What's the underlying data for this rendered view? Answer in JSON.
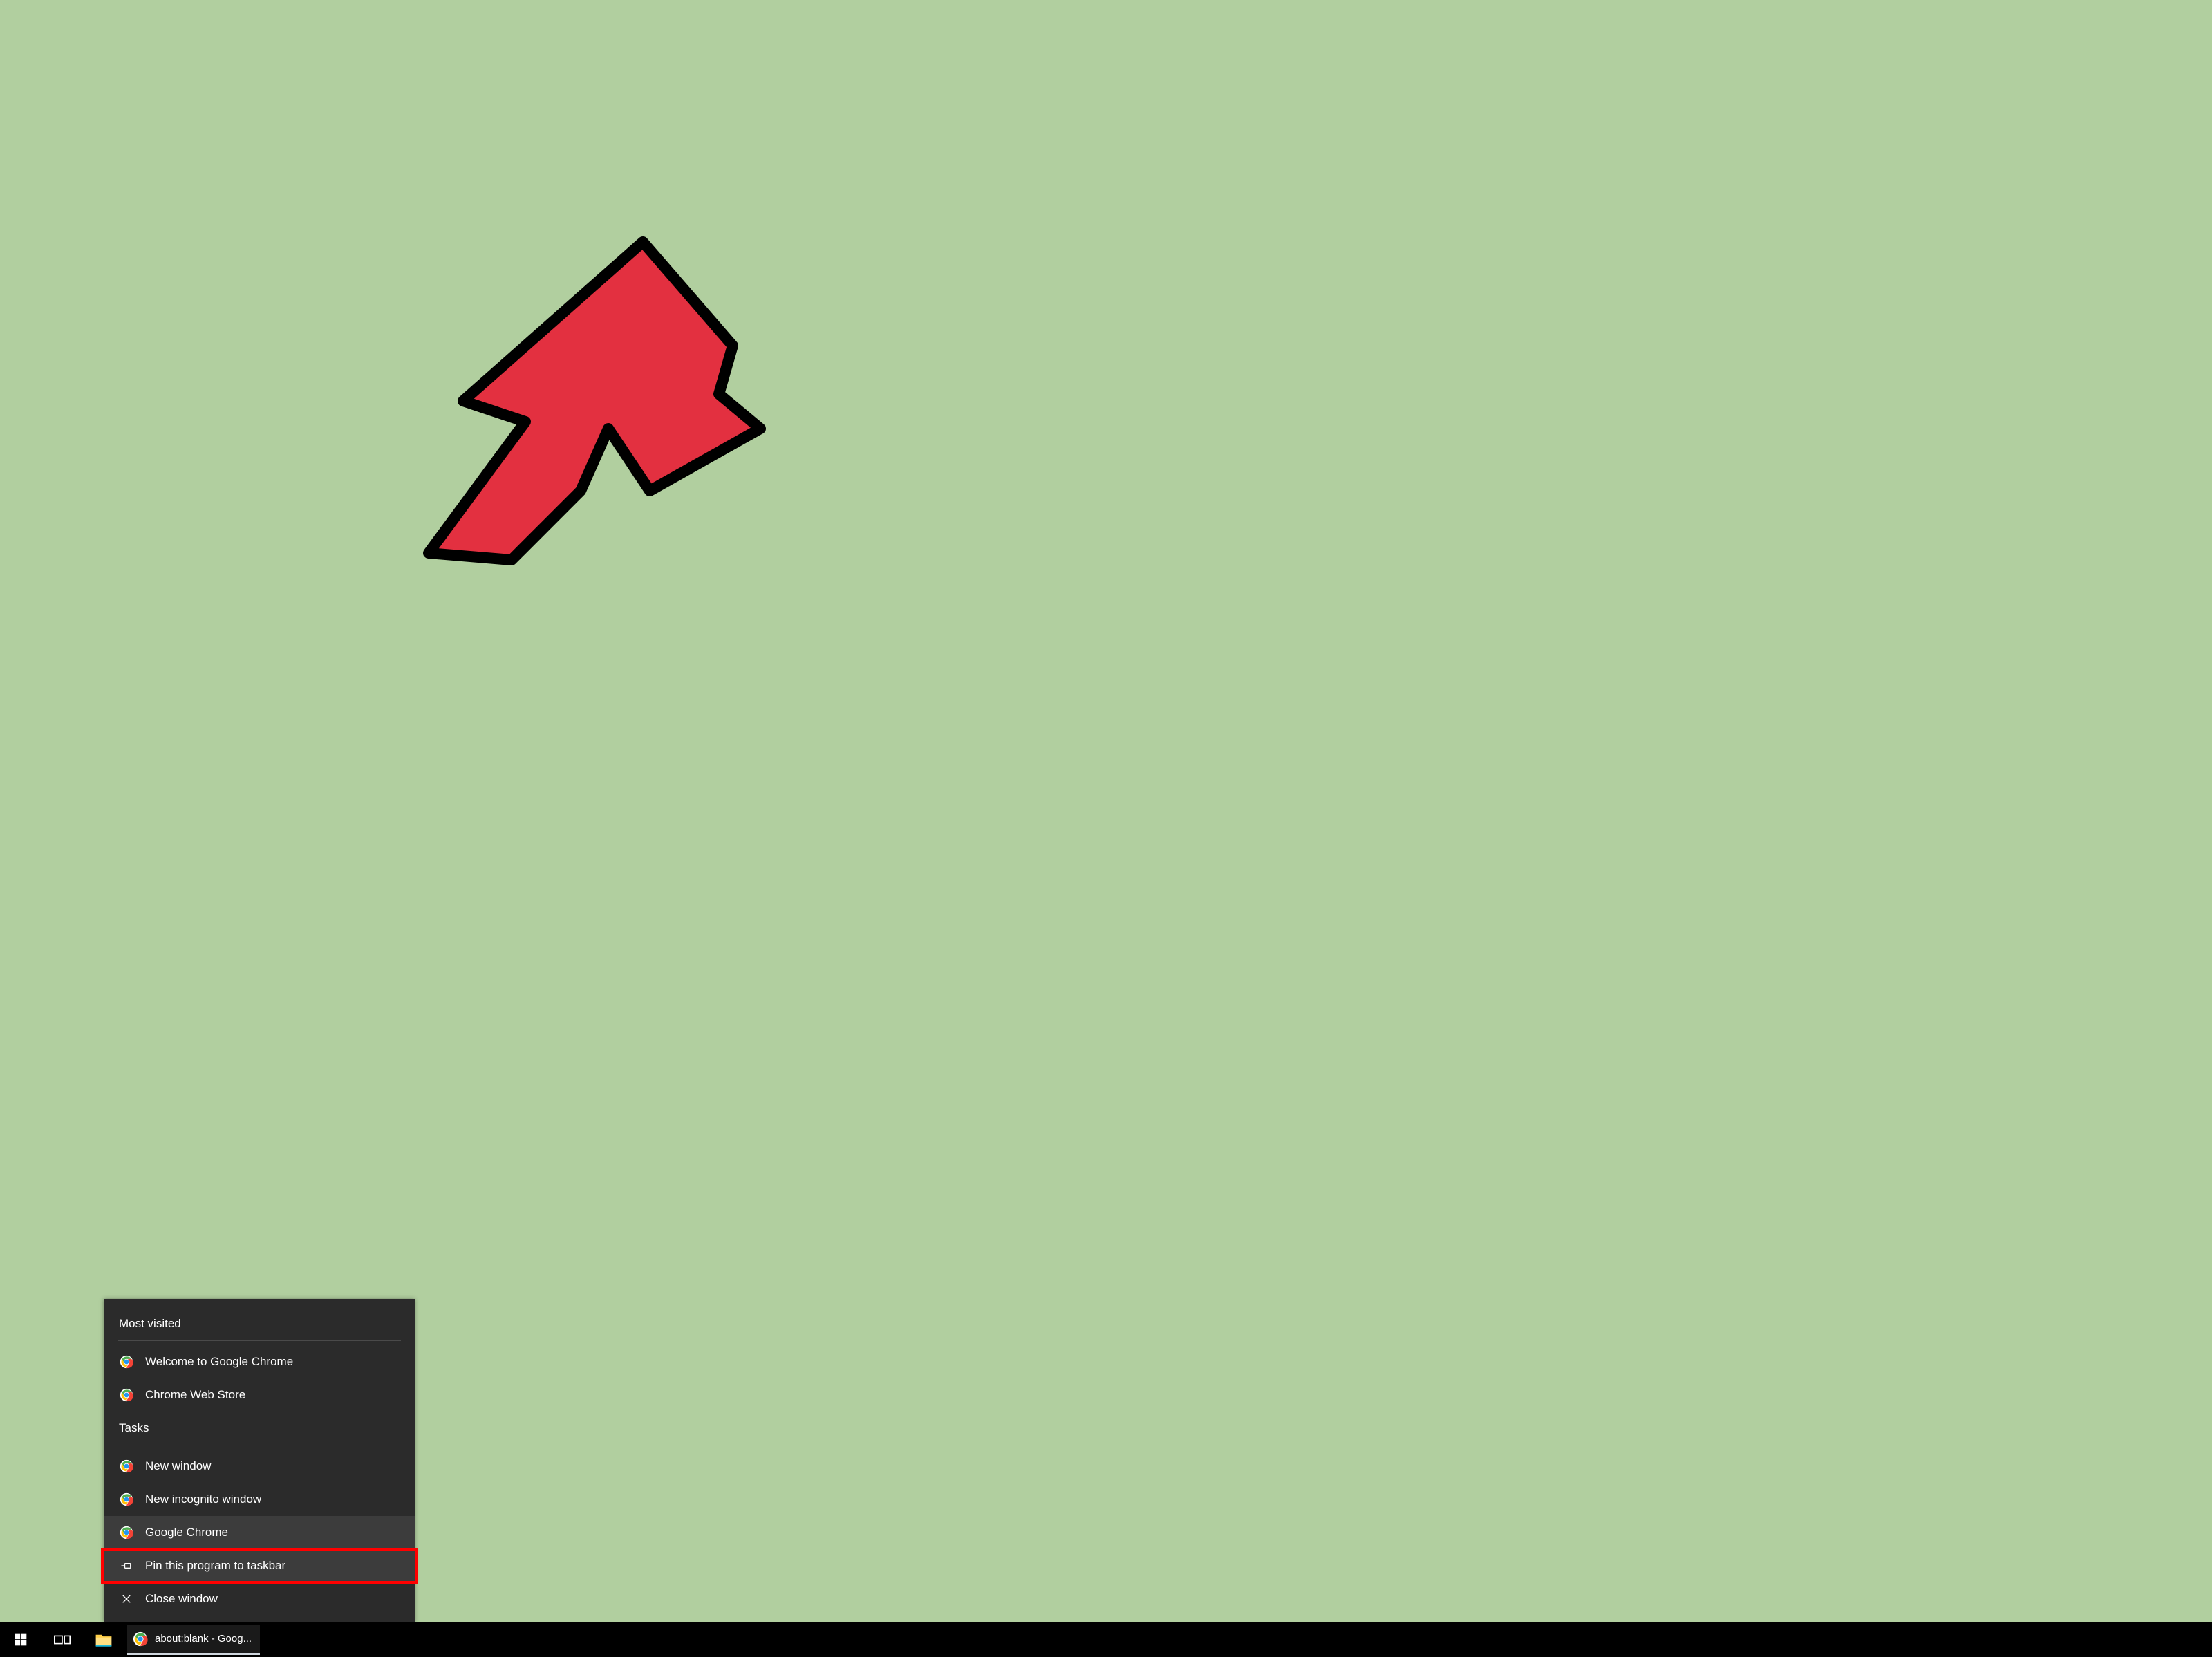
{
  "jump_list": {
    "most_visited_title": "Most visited",
    "most_visited": [
      {
        "label": "Welcome to Google Chrome",
        "icon": "chrome"
      },
      {
        "label": "Chrome Web Store",
        "icon": "chrome"
      }
    ],
    "tasks_title": "Tasks",
    "tasks": [
      {
        "label": "New window",
        "icon": "chrome"
      },
      {
        "label": "New incognito window",
        "icon": "chrome"
      },
      {
        "label": "Google Chrome",
        "icon": "chrome"
      },
      {
        "label": "Pin this program to taskbar",
        "icon": "pin",
        "hovered": true
      },
      {
        "label": "Close window",
        "icon": "close"
      }
    ]
  },
  "taskbar": {
    "running_task_label": "about:blank - Goog..."
  }
}
